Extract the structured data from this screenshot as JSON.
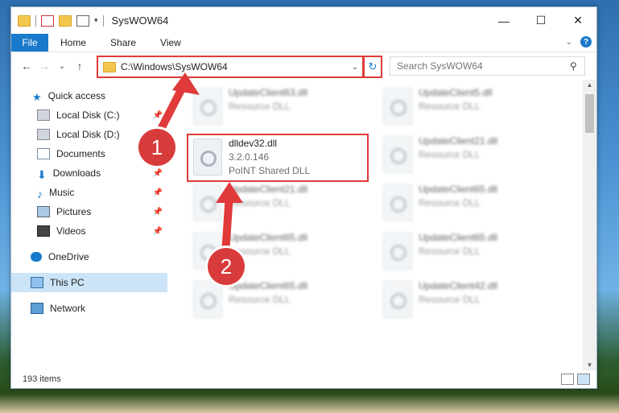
{
  "window": {
    "title": "SysWOW64"
  },
  "ribbon": {
    "file": "File",
    "tabs": [
      "Home",
      "Share",
      "View"
    ]
  },
  "nav": {
    "back": "←",
    "forward": "→",
    "recent": "⌄",
    "up": "↑"
  },
  "address": {
    "path": "C:\\Windows\\SysWOW64"
  },
  "search": {
    "placeholder": "Search SysWOW64"
  },
  "sidebar": {
    "items": [
      {
        "label": "Quick access",
        "icon": "star-icon",
        "pinned": false
      },
      {
        "label": "Local Disk (C:)",
        "icon": "drive-icon",
        "pinned": true
      },
      {
        "label": "Local Disk (D:)",
        "icon": "drive-icon",
        "pinned": false
      },
      {
        "label": "Documents",
        "icon": "documents-icon",
        "pinned": true
      },
      {
        "label": "Downloads",
        "icon": "download-icon",
        "pinned": true
      },
      {
        "label": "Music",
        "icon": "music-icon",
        "pinned": true
      },
      {
        "label": "Pictures",
        "icon": "pictures-icon",
        "pinned": true
      },
      {
        "label": "Videos",
        "icon": "videos-icon",
        "pinned": true
      },
      {
        "label": "OneDrive",
        "icon": "cloud-icon",
        "pinned": false
      },
      {
        "label": "This PC",
        "icon": "pc-icon",
        "pinned": false
      },
      {
        "label": "Network",
        "icon": "network-icon",
        "pinned": false
      }
    ]
  },
  "files": [
    {
      "name": "UpdateClient63.dll",
      "desc": "Resource DLL"
    },
    {
      "name": "UpdateClient5.dll",
      "desc": "Resource DLL"
    },
    {
      "name": "dlldev32.dll",
      "desc": "3.2.0.146",
      "desc2": "PoINT Shared DLL"
    },
    {
      "name": "UpdateClient21.dll",
      "desc": "Resource DLL"
    },
    {
      "name": "UpdateClient21.dll",
      "desc": "Resource DLL"
    },
    {
      "name": "UpdateClient65.dll",
      "desc": "Resource DLL"
    },
    {
      "name": "UpdateClient65.dll",
      "desc": "Resource DLL"
    },
    {
      "name": "UpdateClient65.dll",
      "desc": "Resource DLL"
    },
    {
      "name": "UpdateClient65.dll",
      "desc": "Resource DLL"
    },
    {
      "name": "UpdateClient42.dll",
      "desc": "Resource DLL"
    }
  ],
  "status": {
    "count": "193 items"
  },
  "annotations": {
    "one": "1",
    "two": "2"
  },
  "colors": {
    "accent": "#1979ca",
    "highlight": "#e03a3a",
    "badge": "#d83b3b"
  }
}
